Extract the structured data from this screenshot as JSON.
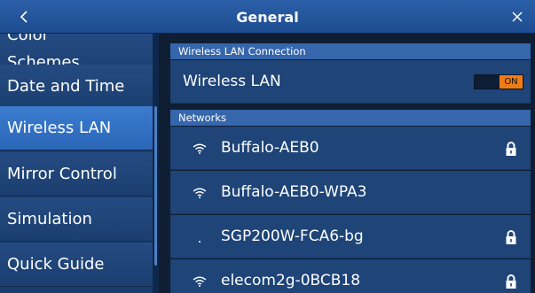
{
  "header": {
    "title": "General",
    "back_icon": "chevron-left-icon",
    "close_icon": "close-icon"
  },
  "sidebar": {
    "items": [
      {
        "label": "Color Schemes",
        "partial_top": "Color",
        "visible": "Schemes",
        "active": false
      },
      {
        "label": "Date and Time",
        "active": false
      },
      {
        "label": "Wireless LAN",
        "active": true
      },
      {
        "label": "Mirror Control",
        "active": false
      },
      {
        "label": "Simulation",
        "active": false
      },
      {
        "label": "Quick Guide",
        "active": false
      }
    ]
  },
  "main": {
    "wlan_section": {
      "title": "Wireless LAN Connection"
    },
    "wlan_row": {
      "label": "Wireless LAN",
      "toggle_state": "ON"
    },
    "networks_section": {
      "title": "Networks"
    },
    "networks": [
      {
        "ssid": "Buffalo-AEB0",
        "locked": true,
        "signal": "strong"
      },
      {
        "ssid": "Buffalo-AEB0-WPA3",
        "locked": false,
        "signal": "strong"
      },
      {
        "ssid": "SGP200W-FCA6-bg",
        "locked": true,
        "signal": "weak"
      },
      {
        "ssid": "elecom2g-0BCB18",
        "locked": true,
        "signal": "strong"
      }
    ]
  },
  "colors": {
    "accent": "#2b66b8",
    "toggle_on": "#f07c14",
    "header": "#1e4d91"
  }
}
